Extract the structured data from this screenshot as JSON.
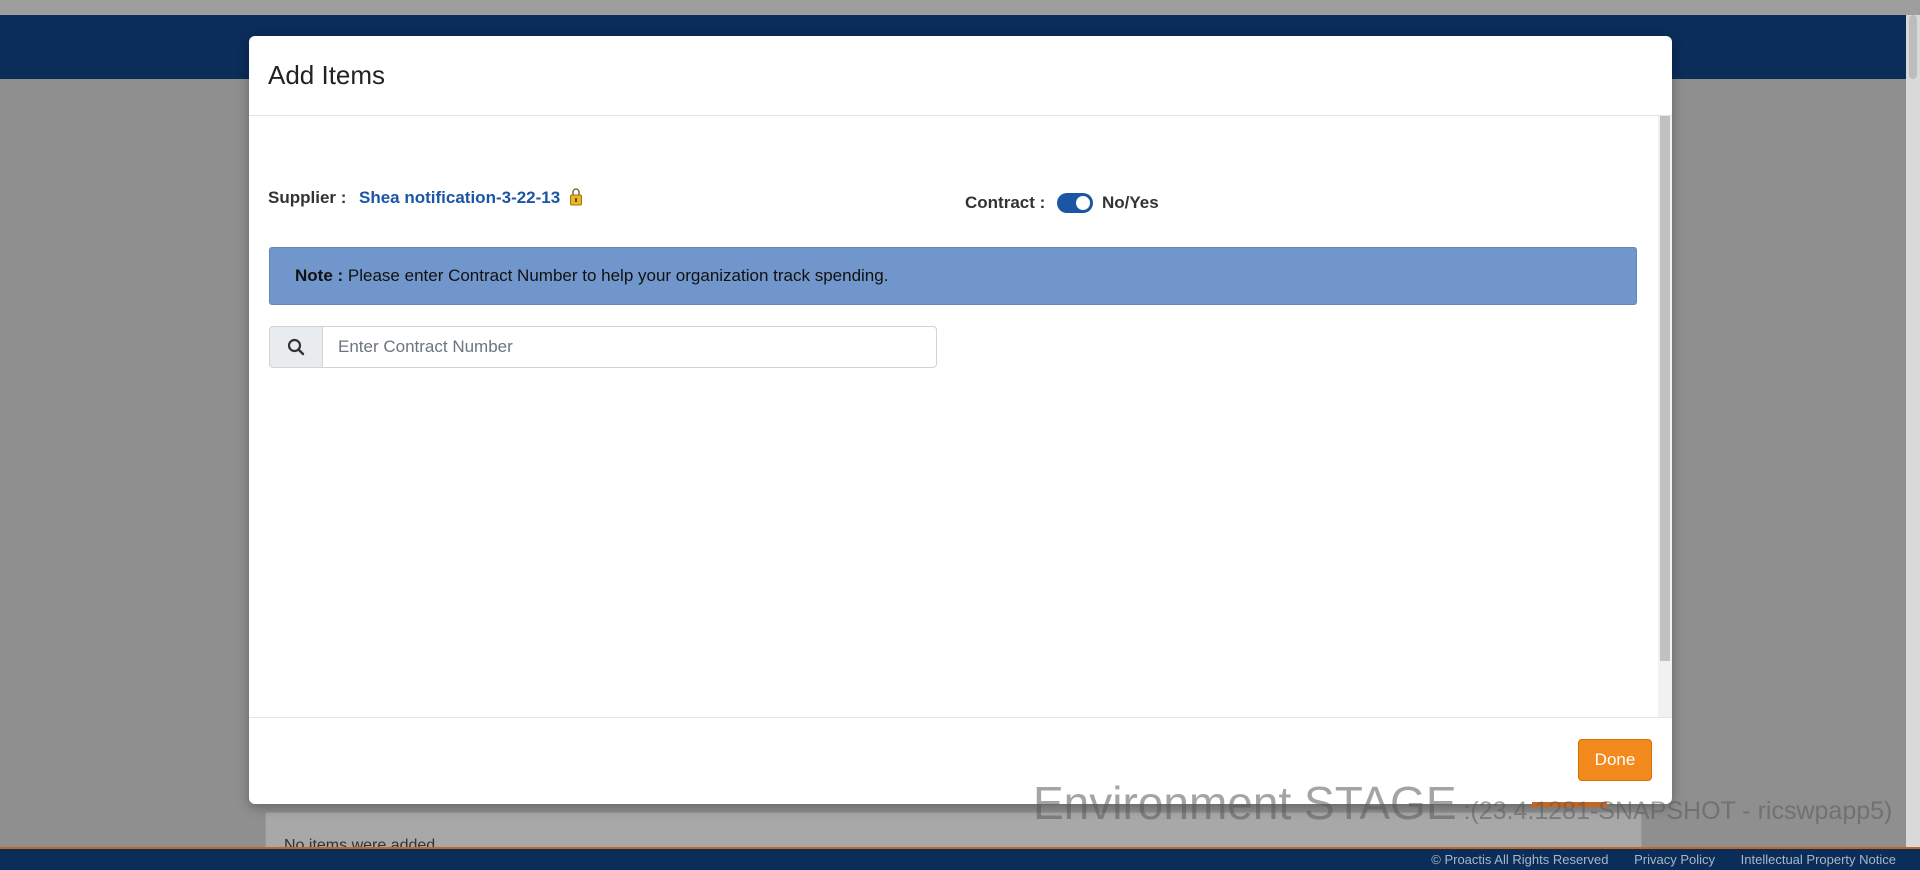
{
  "modal": {
    "title": "Add Items",
    "supplier_label": "Supplier :",
    "supplier_name": "Shea notification-3-22-13",
    "contract_label": "Contract :",
    "contract_toggle_text": "No/Yes",
    "contract_toggle_on": true,
    "note_label": "Note :",
    "note_text": "Please enter Contract Number to help your organization track spending.",
    "search_placeholder": "Enter Contract Number",
    "search_value": "",
    "done_label": "Done"
  },
  "background": {
    "empty_message": "No items were added"
  },
  "watermark": {
    "environment": "Environment  STAGE",
    "build": " :(23.4.1281-SNAPSHOT - ricswpapp5)"
  },
  "footer": {
    "copyright": "© Proactis All Rights Reserved",
    "privacy": "Privacy Policy",
    "ip_notice": "Intellectual Property Notice"
  },
  "colors": {
    "header": "#0b2d5a",
    "link": "#1a55a6",
    "note_bg": "#7196cb",
    "done": "#f28a1e"
  }
}
